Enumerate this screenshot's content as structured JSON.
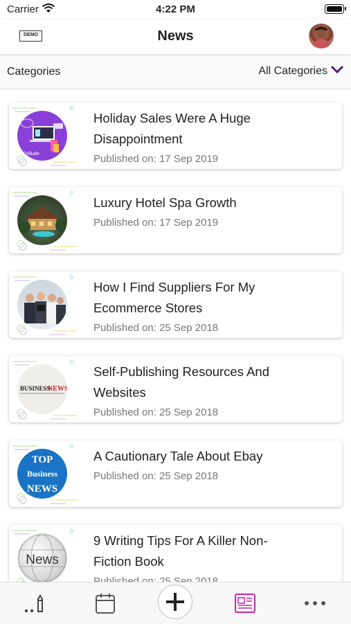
{
  "status_bar": {
    "carrier": "Carrier",
    "time": "4:22 PM"
  },
  "nav": {
    "logo_text": "DEMO",
    "title": "News"
  },
  "category_bar": {
    "label": "Categories",
    "selected": "All Categories"
  },
  "colors": {
    "accent": "#5b1a6e",
    "active_tab": "#c724b1",
    "date_text": "#777777"
  },
  "articles": [
    {
      "title": "Holiday Sales Were A Huge Disappointment",
      "date": "Published on: 17 Sep 2019",
      "thumb_text": ""
    },
    {
      "title": "Luxury Hotel Spa Growth",
      "date": "Published on: 17 Sep 2019",
      "thumb_text": ""
    },
    {
      "title": "How I Find Suppliers For My Ecommerce Stores",
      "date": "Published on: 25 Sep 2018",
      "thumb_text": ""
    },
    {
      "title": "Self-Publishing Resources And Websites",
      "date": "Published on: 25 Sep 2018",
      "thumb_text": "BUSINESS NEWS"
    },
    {
      "title": "A Cautionary Tale About Ebay",
      "date": "Published on: 25 Sep 2018",
      "thumb_text": "TOP Business NEWS"
    },
    {
      "title": "9 Writing Tips For A Killer Non-Fiction Book",
      "date": "Published on: 25 Sep 2018",
      "thumb_text": "News"
    }
  ],
  "tab_bar": {
    "tabs": [
      {
        "icon": "pencil-dots-icon"
      },
      {
        "icon": "calendar-icon"
      },
      {
        "icon": "plus-icon"
      },
      {
        "icon": "newspaper-icon",
        "active": true
      },
      {
        "icon": "more-icon"
      }
    ]
  }
}
